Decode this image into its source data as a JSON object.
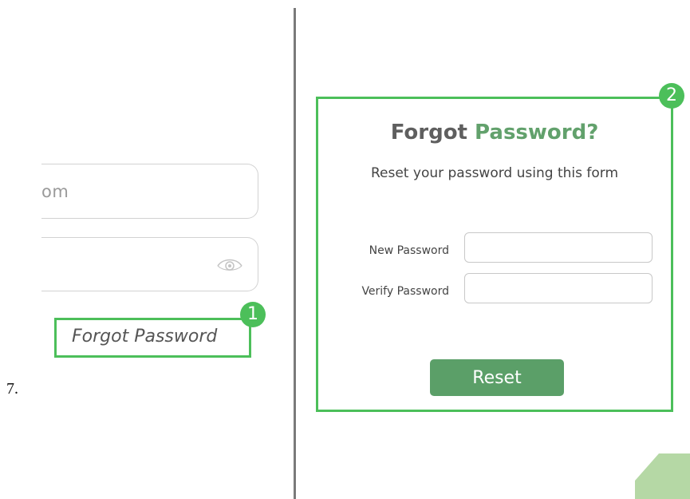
{
  "left_panel": {
    "email_value": "om",
    "forgot_link": "Forgot Password",
    "step_badge": "1"
  },
  "step_number": "7.",
  "reset_card": {
    "step_badge": "2",
    "title_part1": "Forgot",
    "title_part2": "Password?",
    "subtitle": "Reset your password using this form",
    "new_password_label": "New Password",
    "verify_password_label": "Verify Password",
    "new_password_value": "",
    "verify_password_value": "",
    "reset_button": "Reset"
  },
  "colors": {
    "highlight_green": "#4cbf5a",
    "accent_green": "#62a16c",
    "button_green": "#5b9f68",
    "corner_green": "#b5d8a5"
  },
  "icons": {
    "password_toggle": "eye-icon"
  }
}
